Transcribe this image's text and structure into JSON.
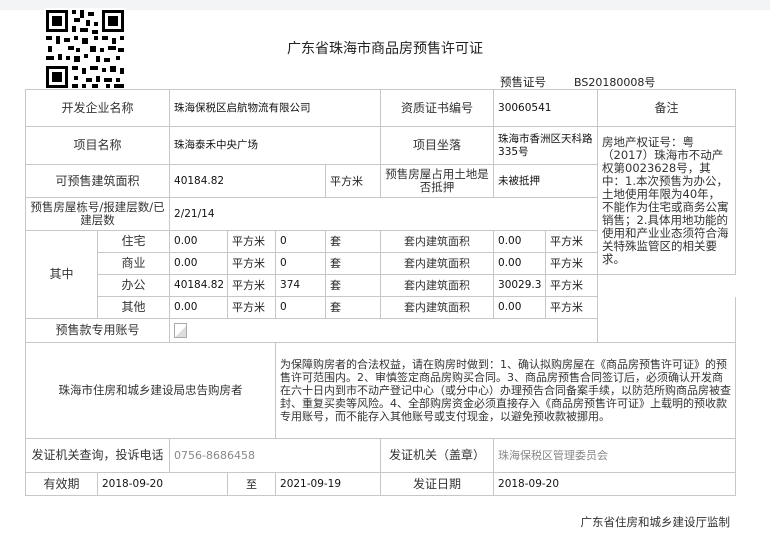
{
  "title": "广东省珠海市商品房预售许可证",
  "permit": {
    "label": "预售证号",
    "number": "BS20180008号"
  },
  "developer": {
    "label": "开发企业名称",
    "value": "珠海保税区启航物流有限公司"
  },
  "qualification": {
    "label": "资质证书编号",
    "value": "30060541"
  },
  "remarks": {
    "label": "备注",
    "text": "房地产权证号：粤（2017）珠海市不动产权第0023628号，其中：1.本次预售为办公，土地使用年限为40年，不能作为住宅或商务公寓销售；2.具体用地功能的使用和产业业态须符合海关特殊监管区的相关要求。"
  },
  "project": {
    "label": "项目名称",
    "value": "珠海泰禾中央广场"
  },
  "location": {
    "label": "项目坐落",
    "value": "珠海市香洲区天科路335号"
  },
  "presale_area": {
    "label": "可预售建筑面积",
    "value": "40184.82",
    "unit": "平方米"
  },
  "mortgage": {
    "label": "预售房屋占用土地是否抵押",
    "value": "未被抵押"
  },
  "building": {
    "label": "预售房屋栋号/报建层数/已建层数",
    "value": "2/21/14"
  },
  "breakdown": {
    "label": "其中",
    "rows": [
      {
        "type": "住宅",
        "area": "0.00",
        "area_unit": "平方米",
        "count": "0",
        "count_unit": "套",
        "inner_label": "套内建筑面积",
        "inner_area": "0.00",
        "inner_unit": "平方米"
      },
      {
        "type": "商业",
        "area": "0.00",
        "area_unit": "平方米",
        "count": "0",
        "count_unit": "套",
        "inner_label": "套内建筑面积",
        "inner_area": "0.00",
        "inner_unit": "平方米"
      },
      {
        "type": "办公",
        "area": "40184.82",
        "area_unit": "平方米",
        "count": "374",
        "count_unit": "套",
        "inner_label": "套内建筑面积",
        "inner_area": "30029.3",
        "inner_unit": "平方米"
      },
      {
        "type": "其他",
        "area": "0.00",
        "area_unit": "平方米",
        "count": "0",
        "count_unit": "套",
        "inner_label": "套内建筑面积",
        "inner_area": "0.00",
        "inner_unit": "平方米"
      }
    ]
  },
  "account": {
    "label": "预售款专用账号"
  },
  "warning": {
    "label": "珠海市住房和城乡建设局忠告购房者",
    "text": "为保障购房者的合法权益，请在购房时做到：1、确认拟购房屋在《商品房预售许可证》的预售许可范围内。2、审慎签定商品房购买合同。3、商品房预售合同签订后，必须确认开发商在六十日内到市不动产登记中心（或分中心）办理预告合同备案手续，以防范所购商品房被查封、重复买卖等风险。4、全部购房资金必须直接存入《商品房预售许可证》上载明的预收款专用账号，而不能存入其他账号或支付现金，以避免预收款被挪用。"
  },
  "contact": {
    "label": "发证机关查询，投诉电话",
    "value": "0756-8686458"
  },
  "authority": {
    "label": "发证机关（盖章）",
    "value": "珠海保税区管理委员会"
  },
  "validity": {
    "label": "有效期",
    "from": "2018-09-20",
    "to_label": "至",
    "to": "2021-09-19"
  },
  "issue_date": {
    "label": "发证日期",
    "value": "2018-09-20"
  },
  "footer": "广东省住房和城乡建设厅监制"
}
